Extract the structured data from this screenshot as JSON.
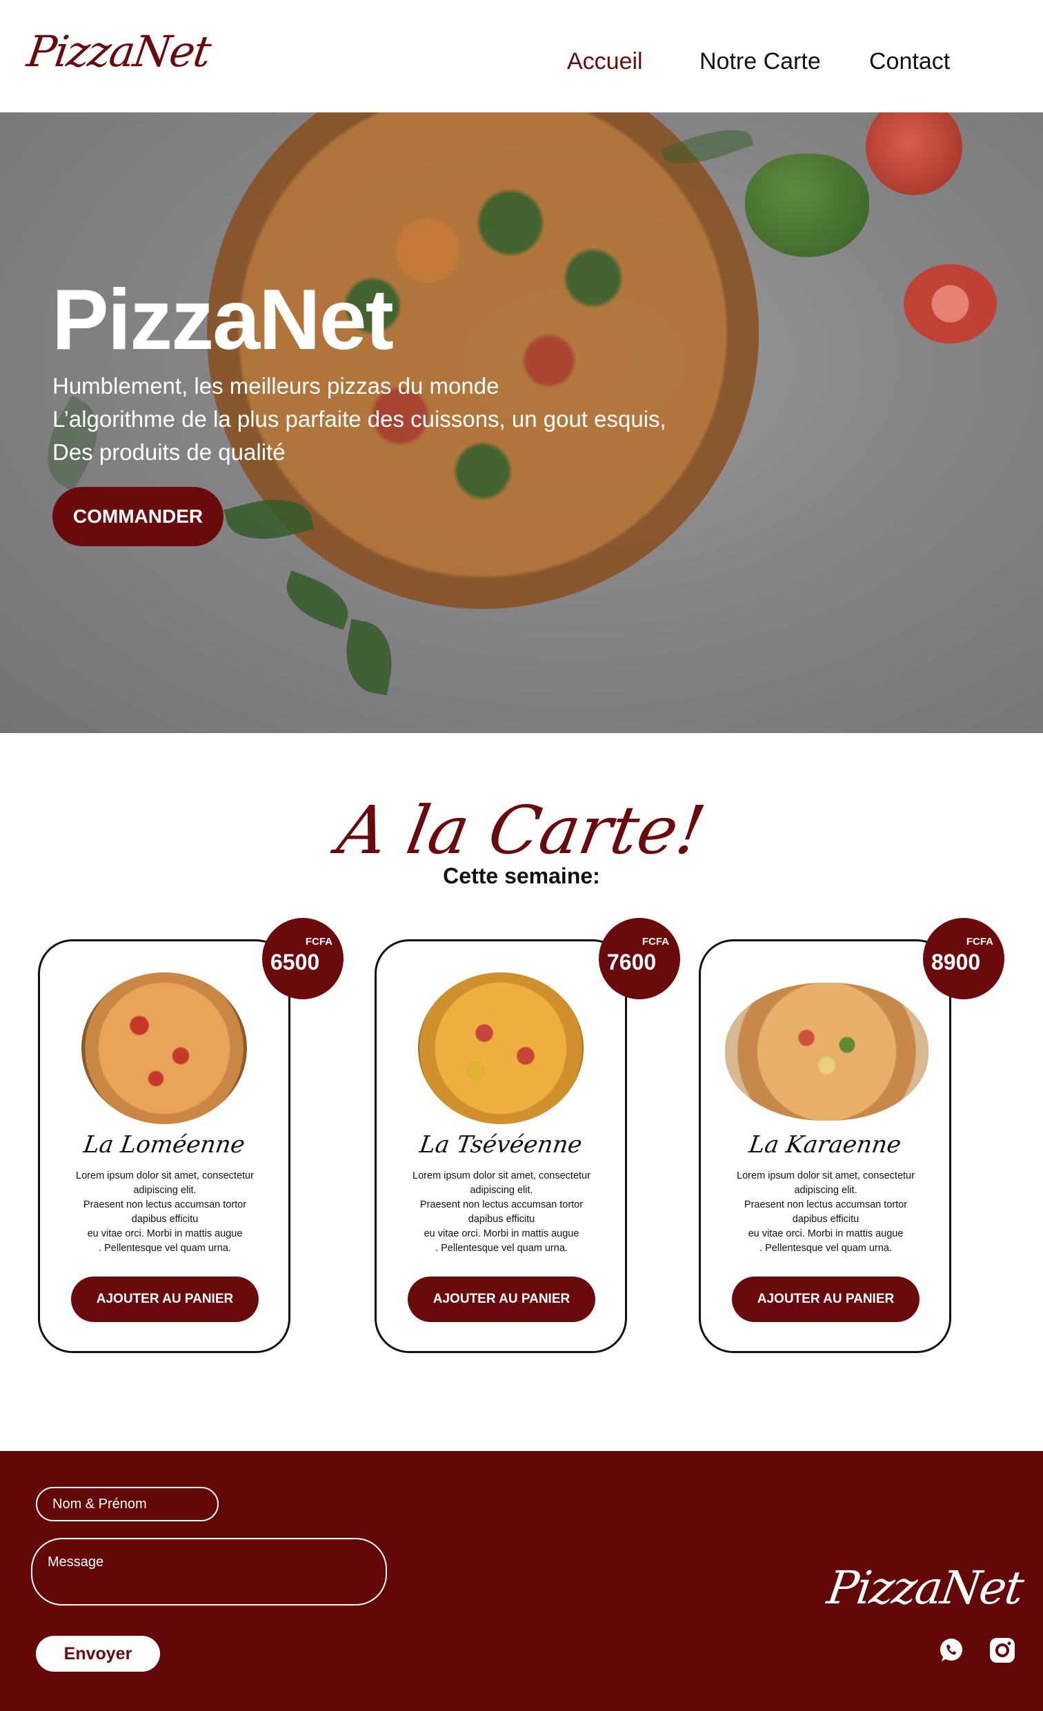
{
  "header": {
    "logo": "PizzaNet",
    "nav": [
      "Accueil",
      "Notre Carte",
      "Contact"
    ]
  },
  "hero": {
    "title": "PizzaNet",
    "lines": [
      "Humblement, les meilleurs pizzas du monde",
      "L’algorithme de la plus parfaite des cuissons, un gout esquis,",
      "Des produits de qualité"
    ],
    "cta": "COMMANDER"
  },
  "menu": {
    "title": "A la Carte!",
    "subtitle": "Cette semaine:",
    "currency": "FCFA",
    "add_label": "AJOUTER AU PANIER",
    "items": [
      {
        "name": "La Loméenne",
        "price": "6500",
        "desc": [
          "Lorem ipsum dolor sit amet, consectetur",
          "adipiscing elit.",
          "Praesent non lectus accumsan tortor",
          "dapibus efficitu",
          "eu vitae orci. Morbi in mattis augue",
          ". Pellentesque vel quam urna."
        ]
      },
      {
        "name": "La Tsévéenne",
        "price": "7600",
        "desc": [
          "Lorem ipsum dolor sit amet, consectetur",
          "adipiscing elit.",
          "Praesent non lectus accumsan tortor",
          "dapibus efficitu",
          "eu vitae orci. Morbi in mattis augue",
          ". Pellentesque vel quam urna."
        ]
      },
      {
        "name": "La Karaenne",
        "price": "8900",
        "desc": [
          "Lorem ipsum dolor sit amet, consectetur",
          "adipiscing elit.",
          "Praesent non lectus accumsan tortor",
          "dapibus efficitu",
          "eu vitae orci. Morbi in mattis augue",
          ". Pellentesque vel quam urna."
        ]
      }
    ]
  },
  "footer": {
    "name_placeholder": "Nom & Prénom",
    "message_placeholder": "Message",
    "send_label": "Envoyer",
    "logo": "PizzaNet"
  },
  "colors": {
    "brand": "#6b0a0d",
    "footer_bg": "#630709"
  },
  "icons": [
    "whatsapp-icon",
    "instagram-icon"
  ]
}
